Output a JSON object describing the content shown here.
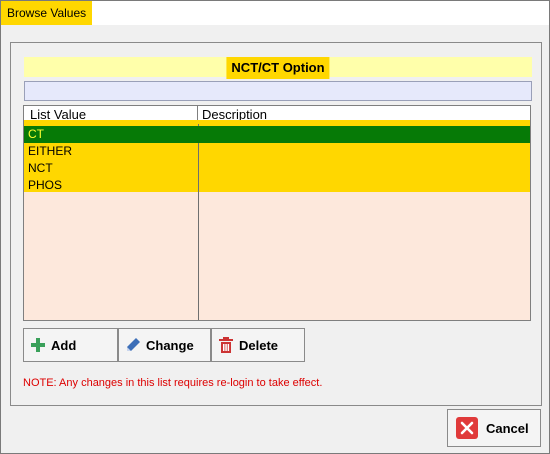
{
  "window": {
    "title": "Browse Values"
  },
  "header": {
    "title": "NCT/CT Option"
  },
  "grid": {
    "columns": [
      "List Value",
      "Description"
    ],
    "rows": [
      {
        "value": "CT",
        "description": "",
        "selected": true
      },
      {
        "value": "EITHER",
        "description": ""
      },
      {
        "value": "NCT",
        "description": ""
      },
      {
        "value": "PHOS",
        "description": ""
      }
    ]
  },
  "buttons": {
    "add": "Add",
    "change": "Change",
    "delete": "Delete",
    "cancel": "Cancel"
  },
  "note": "NOTE: Any changes in this list requires re-login to take effect.",
  "colors": {
    "accent": "#ffd700",
    "selection": "#067a06",
    "note": "#dd0000"
  },
  "icons": {
    "add": "plus-icon",
    "change": "pencil-icon",
    "delete": "trash-icon",
    "cancel": "close-icon"
  }
}
